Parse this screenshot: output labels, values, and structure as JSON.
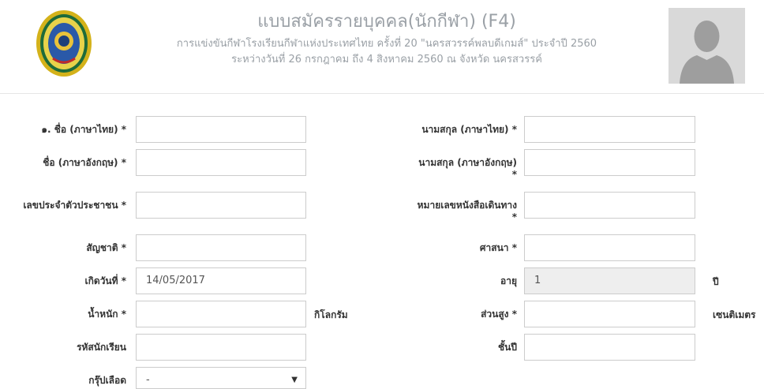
{
  "header": {
    "title": "แบบสมัครรายบุคคล(นักกีฬา) (F4)",
    "subtitle": "การแข่งขันกีฬาโรงเรียนกีฬาแห่งประเทศไทย ครั้งที่ 20 \"นครสวรรค์พลบดีเกมส์\" ประจำปี 2560",
    "subtitle2": "ระหว่างวันที่ 26 กรกฎาคม ถึง 4 สิงหาคม 2560 ณ จังหวัด นครสวรรค์"
  },
  "form": {
    "first_name_th": {
      "label": "๑. ชื่อ (ภาษาไทย) *",
      "value": ""
    },
    "last_name_th": {
      "label": "นามสกุล (ภาษาไทย) *",
      "value": ""
    },
    "first_name_en": {
      "label": "ชื่อ (ภาษาอังกฤษ) *",
      "value": ""
    },
    "last_name_en": {
      "label_line1": "นามสกุล (ภาษาอังกฤษ)",
      "label_line2": "*",
      "value": ""
    },
    "national_id": {
      "label": "เลขประจำตัวประชาชน *",
      "value": ""
    },
    "passport": {
      "label_line1": "หมายเลขหนังสือเดินทาง",
      "label_line2": "*",
      "value": ""
    },
    "nationality": {
      "label": "สัญชาติ *",
      "value": ""
    },
    "religion": {
      "label": "ศาสนา *",
      "value": ""
    },
    "birthdate": {
      "label": "เกิดวันที่ *",
      "value": "14/05/2017"
    },
    "age": {
      "label": "อายุ",
      "value": "1",
      "unit": "ปี"
    },
    "weight": {
      "label": "น้ำหนัก *",
      "value": "",
      "unit": "กิโลกรัม"
    },
    "height": {
      "label": "ส่วนสูง *",
      "value": "",
      "unit": "เซนติเมตร"
    },
    "student_id": {
      "label": "รหัสนักเรียน",
      "value": ""
    },
    "grade": {
      "label": "ชั้นปี",
      "value": ""
    },
    "blood_group": {
      "label": "กรุ๊ปเลือด",
      "value": "-"
    }
  },
  "colors": {
    "border": "#cccccc",
    "readonly_bg": "#eeeeee",
    "header_text": "#9aa0a6"
  }
}
